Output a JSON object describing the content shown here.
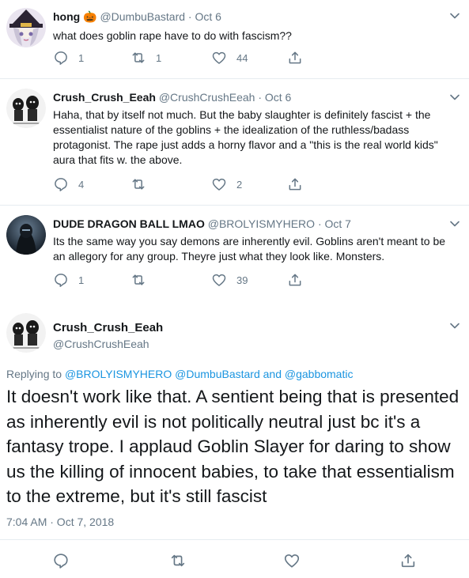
{
  "colors": {
    "text": "#14171a",
    "secondary": "#657786",
    "link": "#1b95e0",
    "divider": "#e6ecf0",
    "thread_line": "#ccd6dd"
  },
  "tweets": [
    {
      "name": "hong",
      "name_emoji": "🎃",
      "handle": "@DumbuBastard",
      "separator": "·",
      "date": "Oct 6",
      "text": "what does goblin rape have to do with fascism??",
      "reply_count": "1",
      "retweet_count": "1",
      "like_count": "44",
      "avatar_icon": "anime-witch-avatar"
    },
    {
      "name": "Crush_Crush_Eeah",
      "handle": "@CrushCrushEeah",
      "separator": "·",
      "date": "Oct 6",
      "text": "Haha, that by itself not much. But the baby slaughter is definitely fascist + the essentialist nature of the goblins + the idealization of the ruthless/badass protagonist. The rape just adds a horny flavor and a \"this is the real world kids\" aura that fits w. the above.",
      "reply_count": "4",
      "retweet_count": "",
      "like_count": "2",
      "avatar_icon": "sketch-figures-avatar"
    },
    {
      "name": "DUDE DRAGON BALL LMAO",
      "handle": "@BROLYISMYHERO",
      "separator": "·",
      "date": "Oct 7",
      "text": "Its the same way you say demons are inherently evil. Goblins aren't meant to be an allegory for any group. Theyre just what they look like. Monsters.",
      "reply_count": "1",
      "retweet_count": "",
      "like_count": "39",
      "avatar_icon": "dark-character-avatar"
    }
  ],
  "main_tweet": {
    "name": "Crush_Crush_Eeah",
    "handle": "@CrushCrushEeah",
    "replying_prefix": "Replying to",
    "reply_to_1": "@BROLYISMYHERO",
    "reply_to_2": "@DumbuBastard",
    "and_word": "and",
    "reply_to_3": "@gabbomatic",
    "text": "It doesn't work like that. A sentient being that is presented as inherently evil is not politically neutral just bc it's a fantasy trope. I applaud Goblin Slayer for daring to show us the killing of innocent babies, to take that essentialism to the extreme, but it's still fascist",
    "timestamp": "7:04 AM · Oct 7, 2018",
    "avatar_icon": "sketch-figures-avatar"
  },
  "icons": {
    "reply": "reply-bubble-icon",
    "retweet": "retweet-arrows-icon",
    "like": "heart-icon",
    "share": "share-upload-icon",
    "more": "chevron-down-icon"
  }
}
